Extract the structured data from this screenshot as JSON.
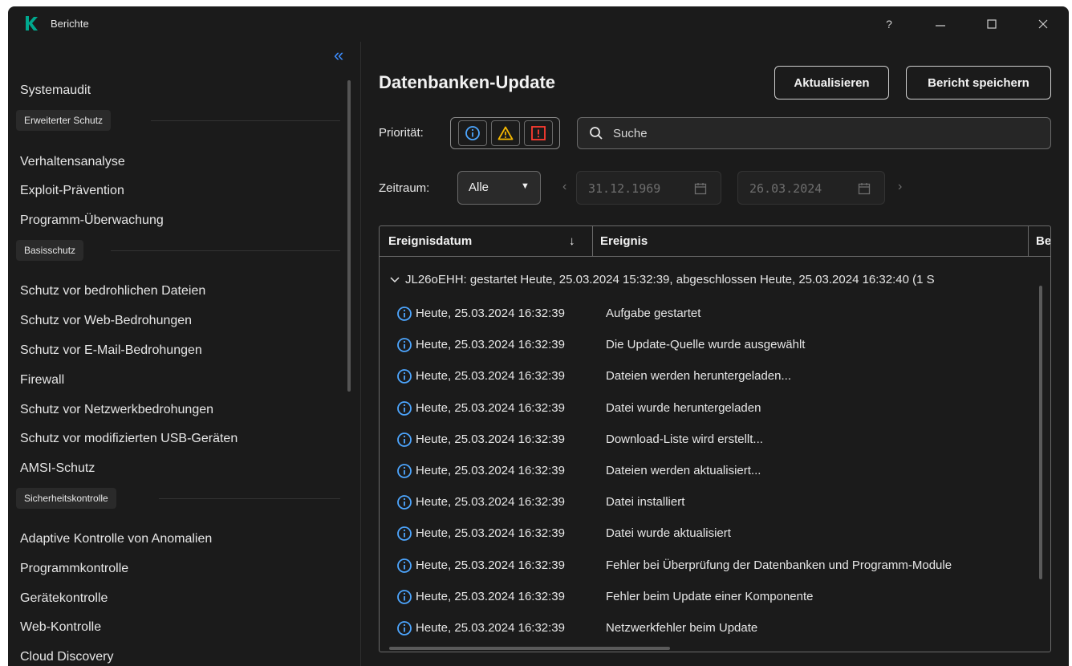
{
  "app": {
    "title": "Berichte",
    "help": "?",
    "accent": "#00a88e"
  },
  "sidebar": {
    "items_top": [
      {
        "label": "Systemaudit"
      }
    ],
    "groups": [
      {
        "label": "Erweiterter Schutz",
        "items": [
          "Verhaltensanalyse",
          "Exploit-Prävention",
          "Programm-Überwachung"
        ]
      },
      {
        "label": "Basisschutz",
        "items": [
          "Schutz vor bedrohlichen Dateien",
          "Schutz vor Web-Bedrohungen",
          "Schutz vor E-Mail-Bedrohungen",
          "Firewall",
          "Schutz vor Netzwerkbedrohungen",
          "Schutz vor modifizierten USB-Geräten",
          "AMSI-Schutz"
        ]
      },
      {
        "label": "Sicherheitskontrolle",
        "items": [
          "Adaptive Kontrolle von Anomalien",
          "Programmkontrolle",
          "Gerätekontrolle",
          "Web-Kontrolle",
          "Cloud Discovery"
        ]
      }
    ]
  },
  "main": {
    "title": "Datenbanken-Update",
    "refresh_label": "Aktualisieren",
    "save_label": "Bericht speichern",
    "priority_label": "Priorität:",
    "search_placeholder": "Suche",
    "period_label": "Zeitraum:",
    "period_value": "Alle",
    "date_from": "31.12.1969",
    "date_to": "26.03.2024"
  },
  "table": {
    "columns": [
      "Ereignisdatum",
      "Ereignis",
      "Be"
    ],
    "sort_indicator": "↓",
    "group_row": "JL26oEHH: gestartet Heute, 25.03.2024 15:32:39, abgeschlossen Heute, 25.03.2024 16:32:40 (1 S",
    "rows": [
      {
        "date": "Heute, 25.03.2024 16:32:39",
        "event": "Aufgabe gestartet"
      },
      {
        "date": "Heute, 25.03.2024 16:32:39",
        "event": "Die Update-Quelle wurde ausgewählt"
      },
      {
        "date": "Heute, 25.03.2024 16:32:39",
        "event": "Dateien werden heruntergeladen..."
      },
      {
        "date": "Heute, 25.03.2024 16:32:39",
        "event": "Datei wurde heruntergeladen"
      },
      {
        "date": "Heute, 25.03.2024 16:32:39",
        "event": "Download-Liste wird erstellt..."
      },
      {
        "date": "Heute, 25.03.2024 16:32:39",
        "event": "Dateien werden aktualisiert..."
      },
      {
        "date": "Heute, 25.03.2024 16:32:39",
        "event": "Datei installiert"
      },
      {
        "date": "Heute, 25.03.2024 16:32:39",
        "event": "Datei wurde aktualisiert"
      },
      {
        "date": "Heute, 25.03.2024 16:32:39",
        "event": "Fehler bei Überprüfung der Datenbanken und Programm-Module"
      },
      {
        "date": "Heute, 25.03.2024 16:32:39",
        "event": "Fehler beim Update einer Komponente"
      },
      {
        "date": "Heute, 25.03.2024 16:32:39",
        "event": "Netzwerkfehler beim Update"
      }
    ]
  },
  "colors": {
    "info": "#4da6ff",
    "warning": "#f5b800",
    "critical": "#ff3b30",
    "link": "#3c8dff"
  }
}
